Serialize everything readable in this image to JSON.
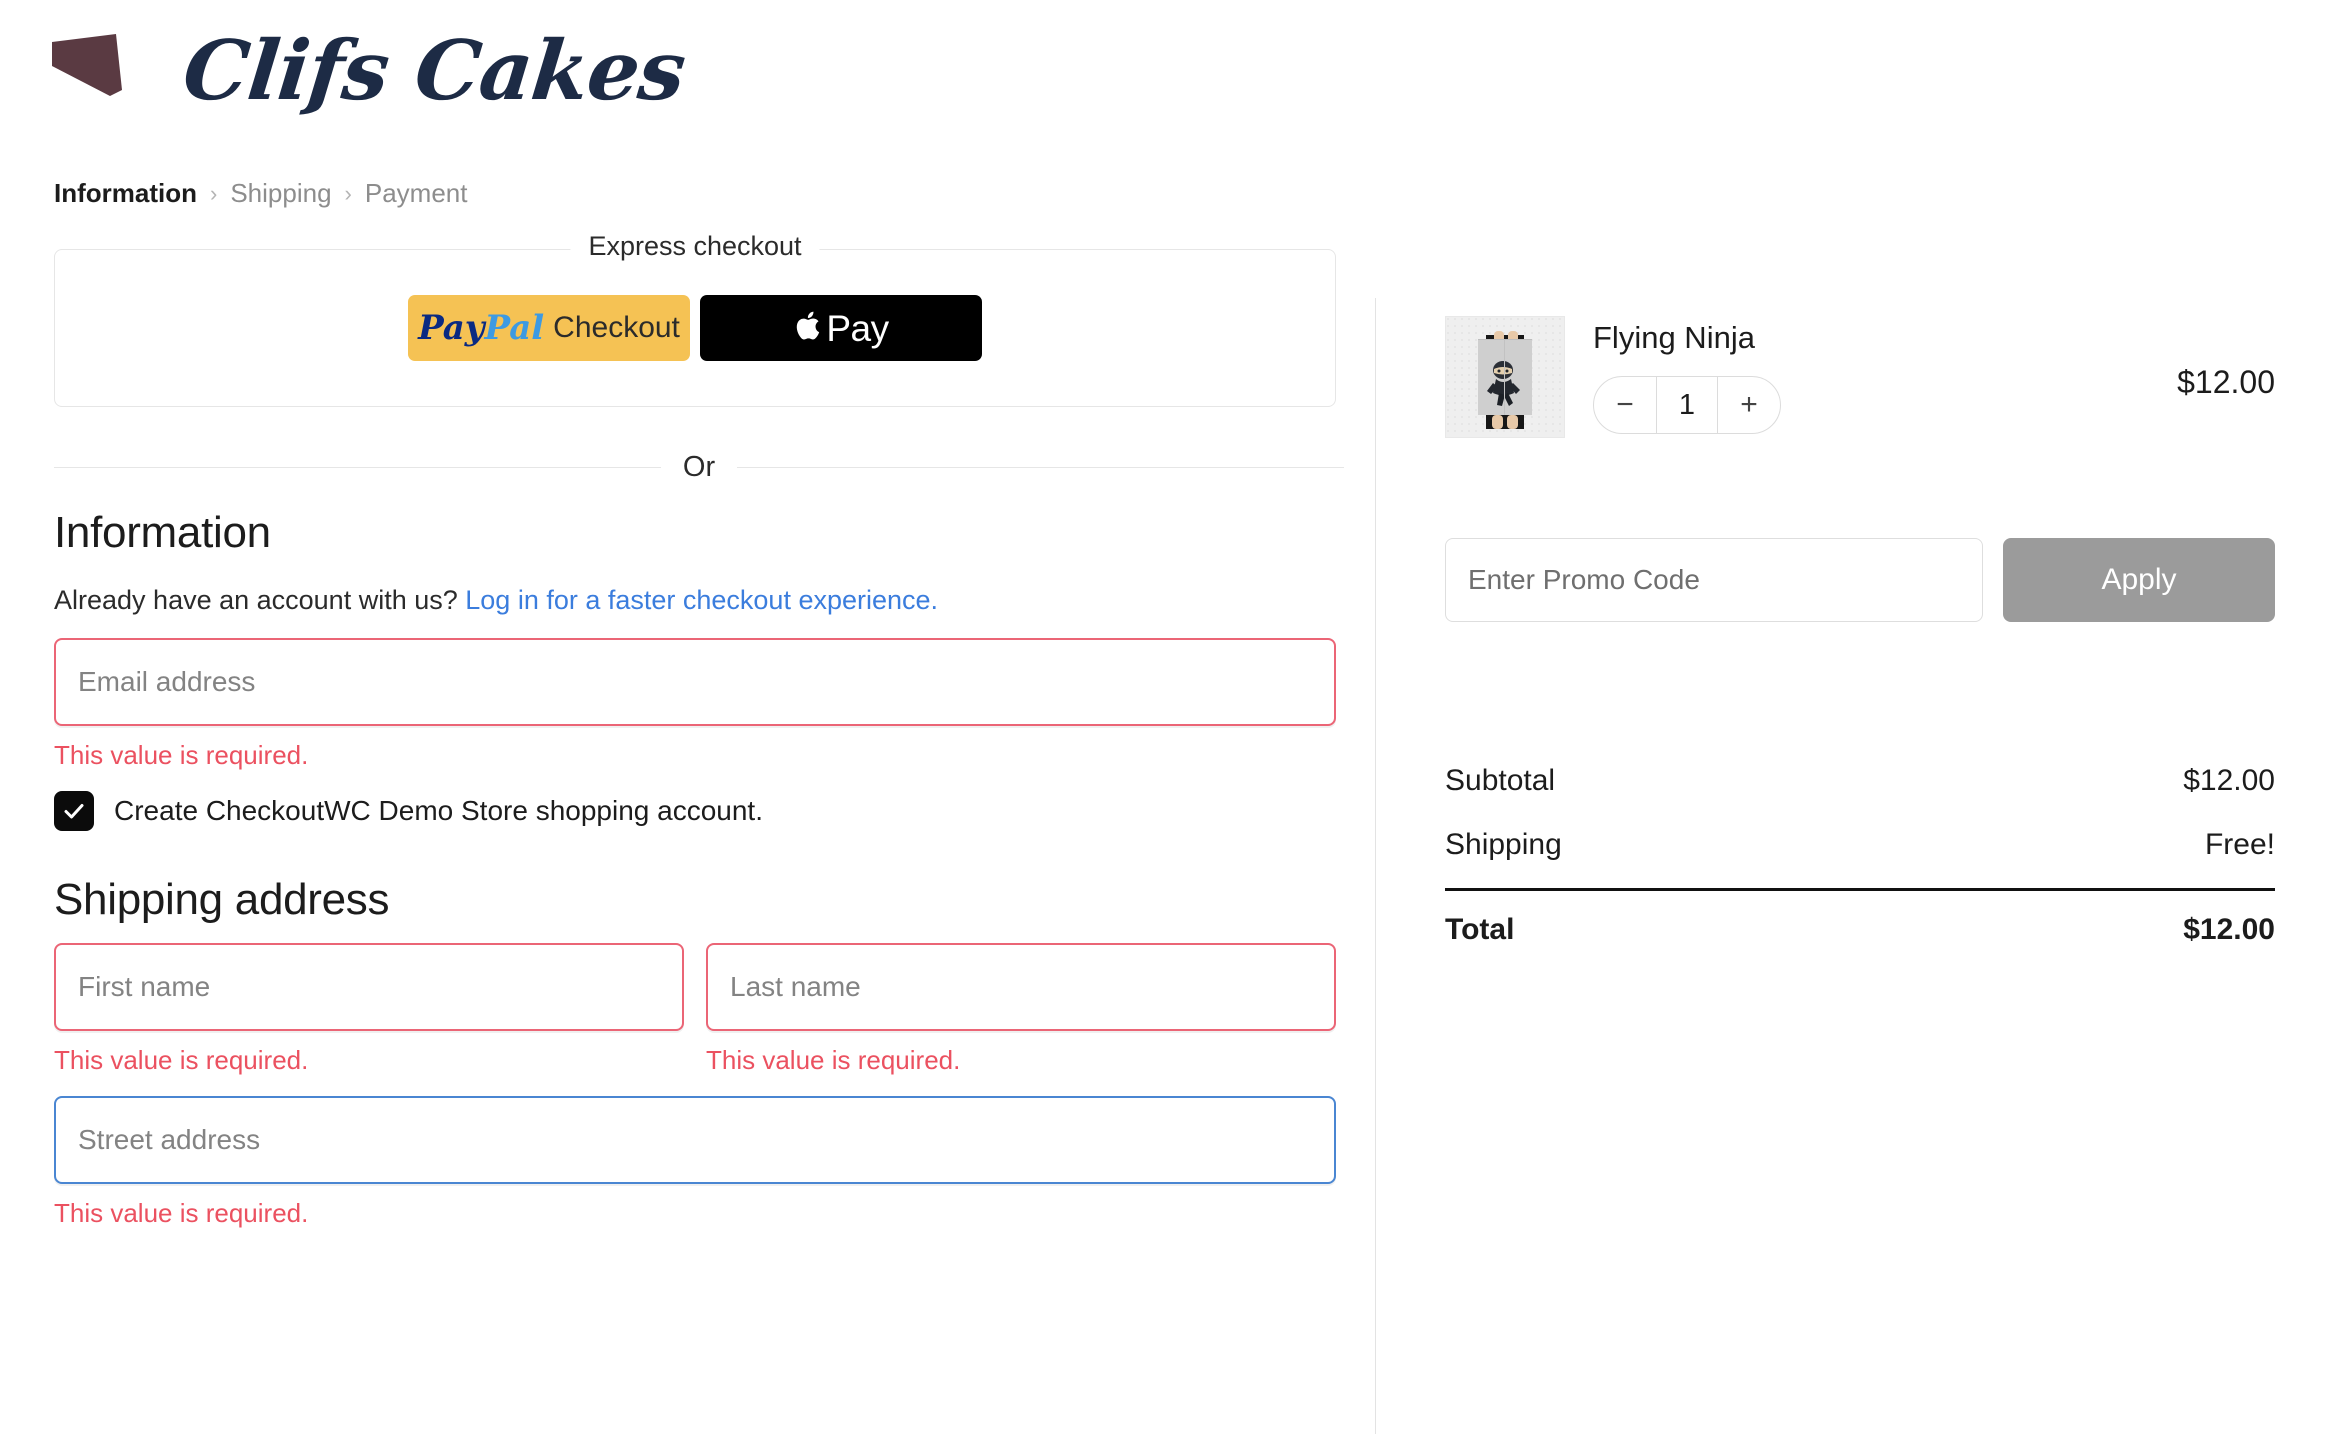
{
  "brand": {
    "name": "Clifs Cakes",
    "logo_icon": "cake-slice-icon",
    "logo_color": "#5a3a42",
    "wordmark_color": "#1d2b45"
  },
  "breadcrumb": {
    "separator": "›",
    "items": [
      {
        "label": "Information",
        "active": true
      },
      {
        "label": "Shipping",
        "active": false
      },
      {
        "label": "Payment",
        "active": false
      }
    ]
  },
  "express_checkout": {
    "legend": "Express checkout",
    "paypal": {
      "pay": "Pay",
      "pal": "Pal",
      "checkout": "Checkout",
      "bg_color": "#f5c254",
      "pay_color": "#0a2a82",
      "pal_color": "#3d9ae2"
    },
    "apple_pay": {
      "label": "Pay",
      "icon": "apple-logo-icon",
      "bg_color": "#000000"
    }
  },
  "or_divider": {
    "label": "Or"
  },
  "information": {
    "heading": "Information",
    "account_prompt": "Already have an account with us?",
    "login_link": "Log in for a faster checkout experience.",
    "login_link_color": "#3b7ddd",
    "email": {
      "placeholder": "Email address",
      "value": "",
      "error": "This value is required.",
      "state": "error"
    },
    "create_account": {
      "label": "Create CheckoutWC Demo Store shopping account.",
      "checked": true,
      "icon": "checkmark-icon"
    }
  },
  "shipping_address": {
    "heading": "Shipping address",
    "first_name": {
      "placeholder": "First name",
      "value": "",
      "error": "This value is required.",
      "state": "error"
    },
    "last_name": {
      "placeholder": "Last name",
      "value": "",
      "error": "This value is required.",
      "state": "error"
    },
    "street_address": {
      "placeholder": "Street address",
      "value": "",
      "error": "This value is required.",
      "state": "focused"
    }
  },
  "order_summary": {
    "product": {
      "name": "Flying Ninja",
      "price": "$12.00",
      "quantity": "1",
      "decrease_label": "−",
      "increase_label": "+",
      "image_alt": "person-holding-ninja-poster"
    },
    "promo": {
      "placeholder": "Enter Promo Code",
      "value": "",
      "apply_label": "Apply",
      "apply_color": "#9b9b9b"
    },
    "totals": [
      {
        "label": "Subtotal",
        "value": "$12.00",
        "grand": false
      },
      {
        "label": "Shipping",
        "value": "Free!",
        "grand": false
      },
      {
        "label": "Total",
        "value": "$12.00",
        "grand": true
      }
    ]
  },
  "colors": {
    "error": "#eb5160",
    "error_border": "#eb6576",
    "focus_border": "#4a86d2",
    "link": "#3b7ddd"
  }
}
